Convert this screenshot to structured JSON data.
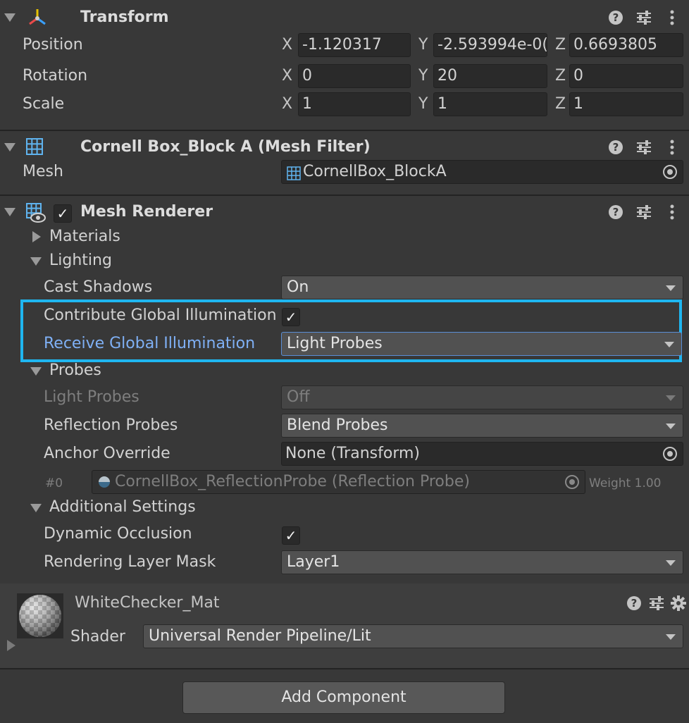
{
  "transform": {
    "title": "Transform",
    "position": {
      "label": "Position",
      "x": "-1.120317",
      "y": "-2.593994e-0(",
      "z": "0.6693805"
    },
    "rotation": {
      "label": "Rotation",
      "x": "0",
      "y": "20",
      "z": "0"
    },
    "scale": {
      "label": "Scale",
      "x": "1",
      "y": "1",
      "z": "1"
    },
    "axis_x": "X",
    "axis_y": "Y",
    "axis_z": "Z"
  },
  "mesh_filter": {
    "title": "Cornell Box_Block A (Mesh Filter)",
    "mesh_label": "Mesh",
    "mesh_value": "CornellBox_BlockA"
  },
  "mesh_renderer": {
    "title": "Mesh Renderer",
    "enabled": true,
    "materials": "Materials",
    "lighting": "Lighting",
    "cast_shadows": {
      "label": "Cast Shadows",
      "value": "On"
    },
    "contribute_gi": {
      "label": "Contribute Global Illumination",
      "checked": true
    },
    "receive_gi": {
      "label": "Receive Global Illumination",
      "value": "Light Probes"
    },
    "probes": "Probes",
    "light_probes": {
      "label": "Light Probes",
      "value": "Off"
    },
    "reflection_probes": {
      "label": "Reflection Probes",
      "value": "Blend Probes"
    },
    "anchor_override": {
      "label": "Anchor Override",
      "value": "None (Transform)"
    },
    "probe_entry": {
      "index": "#0",
      "value": "CornellBox_ReflectionProbe (Reflection Probe)",
      "weight": "Weight 1.00"
    },
    "additional_settings": "Additional Settings",
    "dynamic_occlusion": {
      "label": "Dynamic Occlusion",
      "checked": true
    },
    "rendering_layer_mask": {
      "label": "Rendering Layer Mask",
      "value": "Layer1"
    }
  },
  "material": {
    "name": "WhiteChecker_Mat",
    "shader_label": "Shader",
    "shader_value": "Universal Render Pipeline/Lit"
  },
  "add_component": "Add Component",
  "colors": {
    "highlight": "#1fb6f0",
    "link_label": "#7fb0f5",
    "background": "#383838"
  }
}
